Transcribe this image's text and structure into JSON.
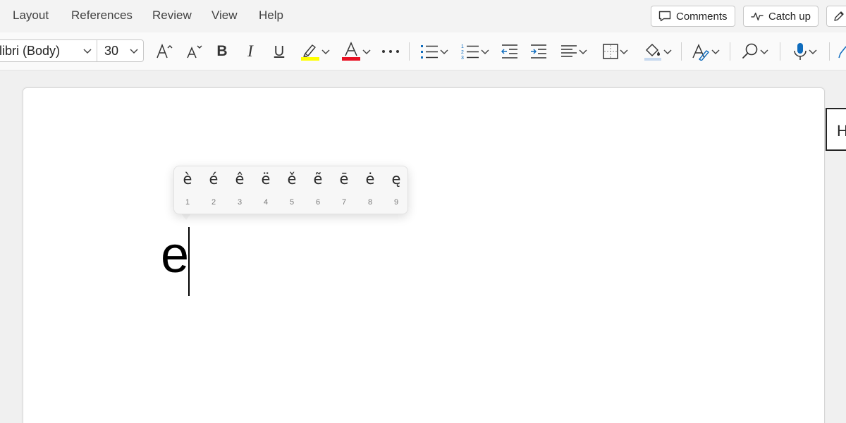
{
  "menubar": {
    "items": [
      {
        "label": "Layout"
      },
      {
        "label": "References"
      },
      {
        "label": "Review"
      },
      {
        "label": "View"
      },
      {
        "label": "Help"
      }
    ],
    "comments_label": "Comments",
    "catch_up_label": "Catch up"
  },
  "ribbon": {
    "font_name": "libri (Body)",
    "font_size": "30",
    "bold_glyph": "B",
    "italic_glyph": "I",
    "underline_glyph": "U",
    "highlight_color": "#ffff00",
    "font_color": "#e81123",
    "accent_blue": "#0f6cbd"
  },
  "accent_popup": {
    "options": [
      {
        "char": "è",
        "key": "1"
      },
      {
        "char": "é",
        "key": "2"
      },
      {
        "char": "ê",
        "key": "3"
      },
      {
        "char": "ë",
        "key": "4"
      },
      {
        "char": "ě",
        "key": "5"
      },
      {
        "char": "ẽ",
        "key": "6"
      },
      {
        "char": "ē",
        "key": "7"
      },
      {
        "char": "ė",
        "key": "8"
      },
      {
        "char": "ę",
        "key": "9"
      }
    ]
  },
  "document": {
    "typed_text": "e",
    "side_label": "H"
  }
}
